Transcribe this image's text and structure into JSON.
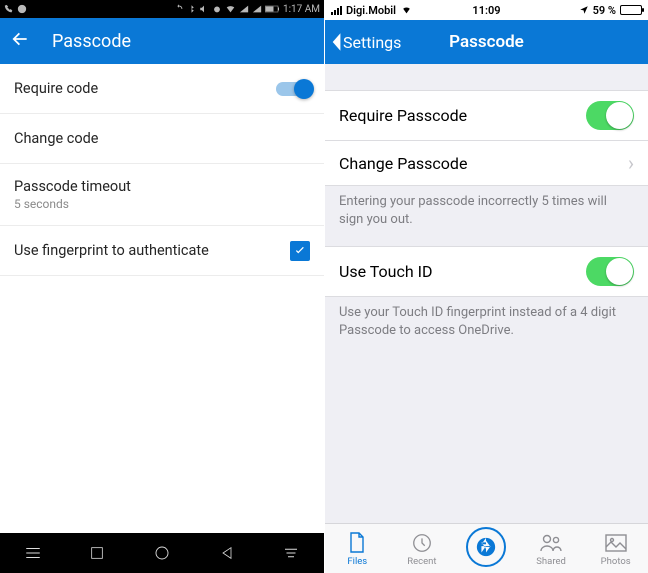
{
  "android": {
    "status": {
      "time": "1:17 AM"
    },
    "header": {
      "title": "Passcode"
    },
    "items": {
      "require": {
        "label": "Require code",
        "on": true
      },
      "change": {
        "label": "Change code"
      },
      "timeout": {
        "label": "Passcode timeout",
        "sub": "5 seconds"
      },
      "fingerprint": {
        "label": "Use fingerprint to authenticate",
        "checked": true
      }
    }
  },
  "ios": {
    "status": {
      "carrier": "Digi.Mobil",
      "time": "11:09",
      "battery_label": "59 %",
      "battery_pct": 59
    },
    "header": {
      "back": "Settings",
      "title": "Passcode"
    },
    "rows": {
      "require": {
        "label": "Require Passcode",
        "on": true
      },
      "change": {
        "label": "Change Passcode"
      },
      "touchid": {
        "label": "Use Touch ID",
        "on": true
      }
    },
    "footers": {
      "attempts": "Entering your passcode incorrectly 5 times will sign you out.",
      "touchid": "Use your Touch ID fingerprint instead of a 4 digit Passcode to access OneDrive."
    },
    "tabs": {
      "files": "Files",
      "recent": "Recent",
      "shared": "Shared",
      "photos": "Photos"
    }
  }
}
